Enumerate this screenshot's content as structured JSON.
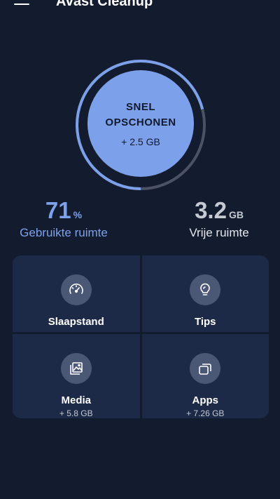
{
  "header": {
    "title": "Avast Cleanup",
    "menu_icon": "hamburger-menu-icon"
  },
  "cleanup_button": {
    "title": "SNEL OPSCHONEN",
    "size": "+ 2.5 GB",
    "ring_fraction": 0.71,
    "ring_color": "#7da0eb",
    "track_color": "#4b5263"
  },
  "stats": {
    "used": {
      "value": "71",
      "unit": "%",
      "label": "Gebruikte ruimte"
    },
    "free": {
      "value": "3.2",
      "unit": "GB",
      "label": "Vrije ruimte"
    }
  },
  "tiles": [
    {
      "label": "Slaapstand",
      "sub": "",
      "icon": "speedometer-icon"
    },
    {
      "label": "Tips",
      "sub": "",
      "icon": "lightbulb-icon"
    },
    {
      "label": "Media",
      "sub": "+ 5.8 GB",
      "icon": "images-icon"
    },
    {
      "label": "Apps",
      "sub": "+ 7.26 GB",
      "icon": "apps-stack-icon"
    }
  ],
  "colors": {
    "background": "#131c2e",
    "tile_bg": "#1d2a47",
    "accent": "#7ea1ec"
  }
}
